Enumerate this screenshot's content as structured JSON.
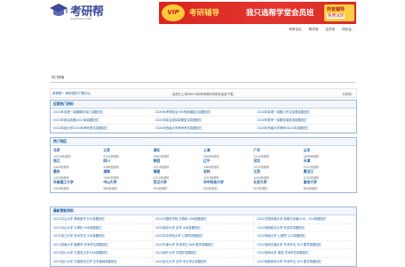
{
  "brand": {
    "name": "考研帮",
    "domain": "KAOYAN.COM"
  },
  "banner": {
    "vip": "VIP",
    "title": "考研辅导",
    "subtitle": "我只选帮学堂会员班",
    "badge_line1": "所有辅导",
    "badge_line2": "免费试听"
  },
  "topnav": [
    "考研论坛",
    "帮学堂",
    "会员班",
    "研友会"
  ],
  "login": {
    "text": "热门搜索"
  },
  "breadcrumb": {
    "home": "考研帮",
    "current": "› 考研资料下载中心",
    "notice": "目前已上传89816份考研资料供研友免费下载。",
    "share": "分享到："
  },
  "recent": {
    "title": "近期热门资料",
    "links": [
      "2020年英语一真题解析词汇真题回忆",
      "2020年考研政治789份精编复试真题回忆",
      "2020年英语一真题小作文英语真题回忆",
      "2020年政治真题2022版真题回忆",
      "2020年政治选择真题复试真题回忆",
      "2020年数学一真题答案英语真题回忆",
      "2020年各大学2020年考研考试真题回忆",
      "2020年西南大学考研考试真题回忆",
      "2020年西南大学考研2022年真题回忆"
    ]
  },
  "regions": {
    "title": "热门地区",
    "items": [
      {
        "name": "北京",
        "count": "10254份资料"
      },
      {
        "name": "江苏",
        "count": "5124份资料"
      },
      {
        "name": "湖北",
        "count": "3867份资料"
      },
      {
        "name": "上海",
        "count": "3560份资料"
      },
      {
        "name": "广东",
        "count": "3114份资料"
      },
      {
        "name": "山东",
        "count": "2836份资料"
      },
      {
        "name": "浙江",
        "count": "2402份资料"
      },
      {
        "name": "四川",
        "count": "2268份资料"
      },
      {
        "name": "陕西",
        "count": "2013份资料"
      },
      {
        "name": "辽宁",
        "count": "1964份资料"
      },
      {
        "name": "河北",
        "count": "1572份资料"
      },
      {
        "name": "天津",
        "count": "1507份资料"
      },
      {
        "name": "重庆",
        "count": "1432份资料"
      },
      {
        "name": "湖南",
        "count": "1365份资料"
      },
      {
        "name": "福建",
        "count": "1210份资料"
      },
      {
        "name": "吉林",
        "count": "1157份资料"
      },
      {
        "name": "江西",
        "count": "1043份资料"
      },
      {
        "name": "黑龙江",
        "count": "1032份资料"
      },
      {
        "name": "华南理工大学",
        "count": "1005份资料"
      },
      {
        "name": "中山大学",
        "count": "980份资料"
      },
      {
        "name": "武汉大学",
        "count": "954份资料"
      },
      {
        "name": "华中科技大学",
        "count": "932份资料"
      },
      {
        "name": "北京大学",
        "count": "907份资料"
      },
      {
        "name": "南京大学",
        "count": "880份资料"
      }
    ]
  },
  "latest": {
    "title": "最新更新资料",
    "left": [
      "2022中山大学 基础医学 870真题回忆",
      "2022中山大学 计算机 908真题回忆",
      "2022浙江大学 学术学位 326真题回忆",
      "2022西南大学 管理学 学术学位真题回忆",
      "2022四川大学 汉语言文学 818真题回忆",
      "2022四川大学 中国语言文学 文学基础真题回忆"
    ],
    "right": [
      "2022中国传媒大学 新闻与传播 440、334真题回忆",
      "2022西南政法大学 刑法学真题回忆",
      "2022西南大学 心理学 312真题回忆",
      "2022西南交通大学 学术学位 303 数学真题回忆",
      "2022西南大学 英语 学术学位真题回忆",
      "2022首都师范大学 学术学位 303 数学真题回忆"
    ],
    "mid": [
      "2022中国科学院 计算机 408真题回忆",
      "2022南京大学 法学 408真题回忆",
      "2022华中师范大学 心理学真题回忆",
      "2022天津大学 学术学位 808 数学真题回忆",
      "2022南开大学 中国史真题回忆",
      "2022武汉大学 法学 专业学位真题回忆"
    ]
  }
}
